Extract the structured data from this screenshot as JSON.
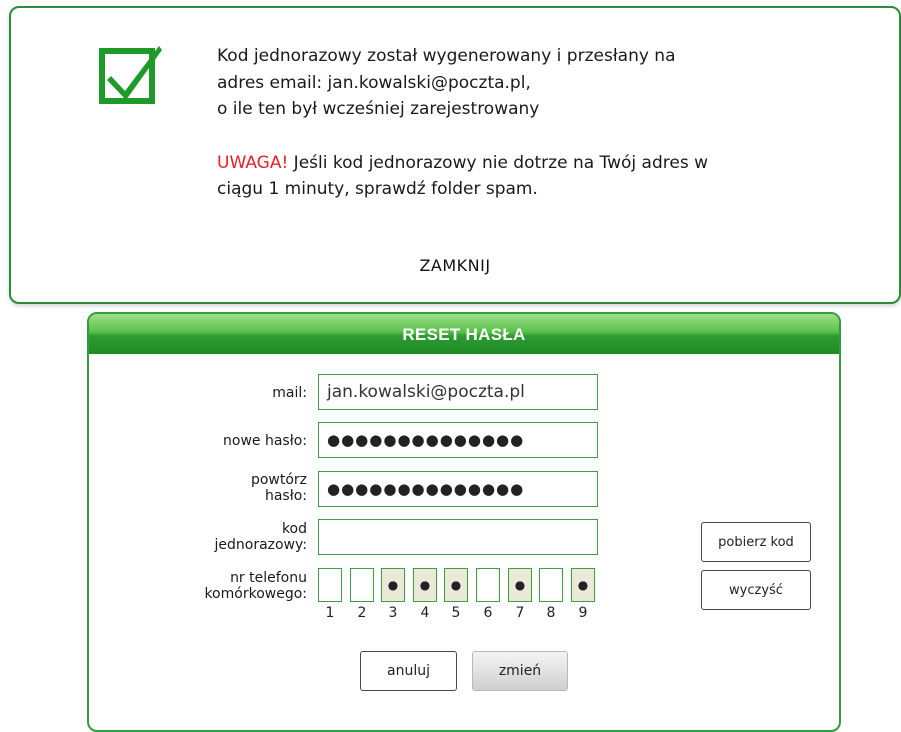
{
  "popup": {
    "message_lines": [
      "Kod jednorazowy został wygenerowany i przesłany na",
      "adres email: jan.kowalski@poczta.pl,",
      "o ile ten był wcześniej zarejestrowany"
    ],
    "warning_label": "UWAGA!",
    "warning_rest": " Jeśli kod jednorazowy nie dotrze na Twój adres w",
    "warning_line2": "ciągu 1 minuty, sprawdź folder spam.",
    "close_label": "ZAMKNIJ",
    "icon": "checkmark-icon",
    "accent_color": "#1f9a2a"
  },
  "form": {
    "title": "RESET HASŁA",
    "mail_label": "mail:",
    "mail_value": "jan.kowalski@poczta.pl",
    "new_password_label": "nowe hasło:",
    "new_password_mask": "●●●●●●●●●●●●●●",
    "repeat_password_label_1": "powtórz",
    "repeat_password_label_2": "hasło:",
    "repeat_password_mask": "●●●●●●●●●●●●●●",
    "code_label_1": "kod",
    "code_label_2": "jednorazowy:",
    "code_value": "",
    "phone_label_1": "nr telefonu",
    "phone_label_2": "komórkowego:",
    "phone_digits": [
      {
        "index": "1",
        "masked": false,
        "value": ""
      },
      {
        "index": "2",
        "masked": false,
        "value": ""
      },
      {
        "index": "3",
        "masked": true,
        "value": "●"
      },
      {
        "index": "4",
        "masked": true,
        "value": "●"
      },
      {
        "index": "5",
        "masked": true,
        "value": "●"
      },
      {
        "index": "6",
        "masked": false,
        "value": ""
      },
      {
        "index": "7",
        "masked": true,
        "value": "●"
      },
      {
        "index": "8",
        "masked": false,
        "value": ""
      },
      {
        "index": "9",
        "masked": true,
        "value": "●"
      }
    ],
    "get_code_label": "pobierz kod",
    "clear_label": "wyczyść",
    "cancel_label": "anuluj",
    "change_label": "zmień",
    "border_color": "#2f9e3c"
  }
}
